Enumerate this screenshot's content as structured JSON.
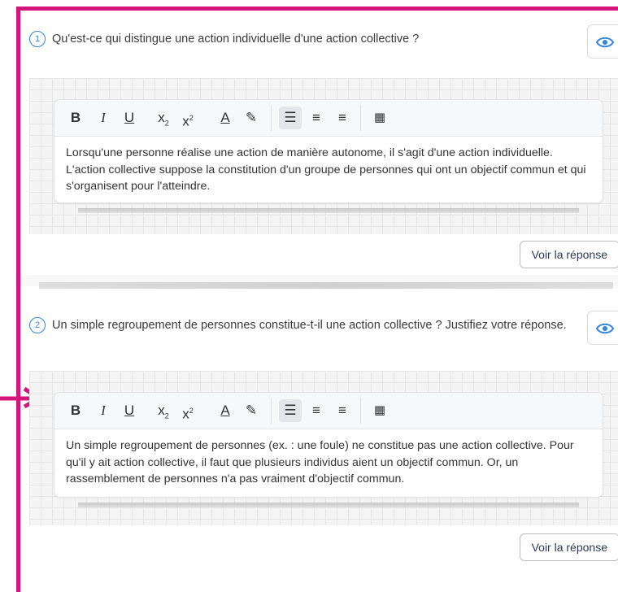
{
  "question_1": {
    "number": "1",
    "text": "Qu'est-ce qui distingue une action individuelle d'une action collective ?",
    "answer_text": "Lorsqu'une personne réalise une action de manière autonome, il s'agit d'une action individuelle. L'action collective suppose la constitution d'un groupe de personnes qui ont un objectif commun et qui s'organisent pour l'atteindre.",
    "show_answer_label": "Voir la réponse"
  },
  "question_2": {
    "number": "2",
    "text": "Un simple regroupement de personnes constitue-t-il une action collective ? Justifiez votre réponse.",
    "answer_text": "Un simple regroupement de personnes (ex. : une foule) ne constitue pas une action collective. Pour qu'il y ait action collective, il faut que plusieurs individus aient un objectif commun. Or, un rassemblement de personnes n'a pas vraiment d'objectif commun.",
    "show_answer_label": "Voir la réponse"
  },
  "toolbar": {
    "bold": "B",
    "italic": "I",
    "underline": "U",
    "subscript": "x",
    "superscript": "x",
    "font_color": "A",
    "icons": [
      "bold-icon",
      "italic-icon",
      "underline-icon",
      "subscript-icon",
      "superscript-icon",
      "font-color-icon",
      "highlighter-icon",
      "align-left-icon",
      "align-center-icon",
      "align-right-icon",
      "table-icon"
    ]
  },
  "colors": {
    "frame": "#d4157c",
    "accent": "#2f86d6",
    "button_text": "#2b3a55"
  }
}
